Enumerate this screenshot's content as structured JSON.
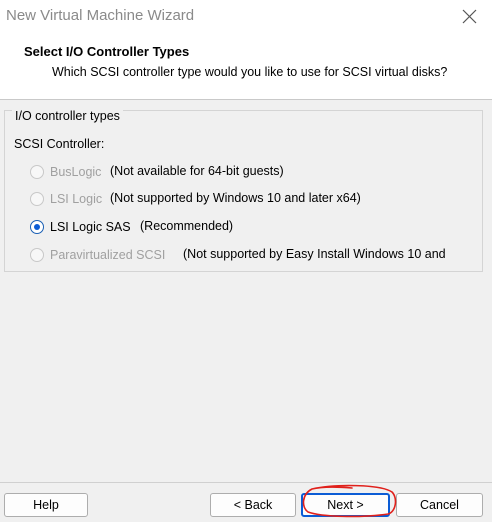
{
  "window": {
    "title": "New Virtual Machine Wizard"
  },
  "header": {
    "title": "Select I/O Controller Types",
    "subtitle": "Which SCSI controller type would you like to use for SCSI virtual disks?"
  },
  "group": {
    "legend": "I/O controller types",
    "section_label": "SCSI Controller:",
    "options": [
      {
        "label": "BusLogic",
        "note": "(Not available for 64-bit guests)",
        "enabled": false,
        "selected": false
      },
      {
        "label": "LSI Logic",
        "note": "(Not supported by Windows 10 and later x64)",
        "enabled": false,
        "selected": false
      },
      {
        "label": "LSI Logic SAS",
        "note": "(Recommended)",
        "enabled": true,
        "selected": true
      },
      {
        "label": "Paravirtualized SCSI",
        "note": "(Not supported by Easy Install Windows 10 and",
        "enabled": false,
        "selected": false
      }
    ]
  },
  "buttons": {
    "help": "Help",
    "back": "< Back",
    "next": "Next >",
    "cancel": "Cancel"
  },
  "colors": {
    "accent": "#0b5cd5",
    "annotation": "#e0201b",
    "disabled_text": "#a0a0a0"
  },
  "icons": {
    "close": "close-icon"
  }
}
